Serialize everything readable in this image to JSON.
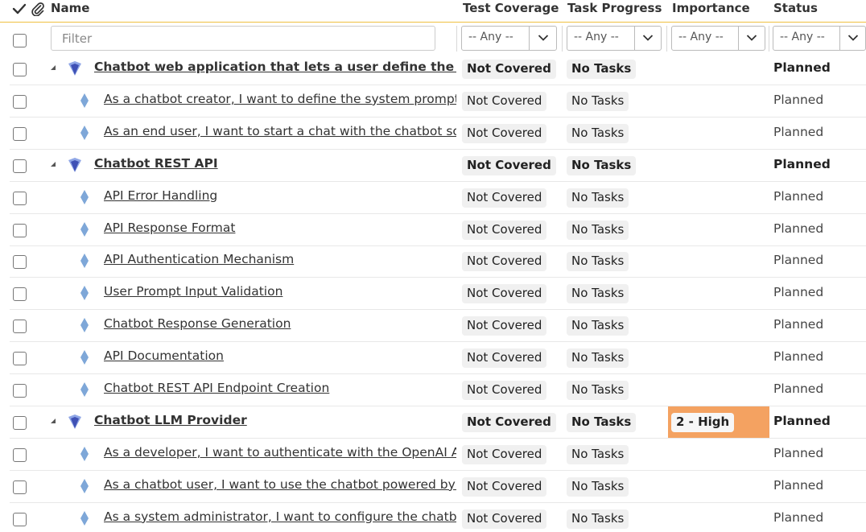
{
  "header": {
    "name": "Name",
    "test_coverage": "Test Coverage",
    "task_progress": "Task Progress",
    "importance": "Importance",
    "status": "Status"
  },
  "filters": {
    "name_placeholder": "Filter",
    "test_coverage": "-- Any --",
    "task_progress": "-- Any --",
    "importance": "-- Any --",
    "status": "-- Any --"
  },
  "colors": {
    "epic_icon": "#3f51b5",
    "requirement_icon": "#7ea7d8",
    "importance_high": "#f4a261",
    "header_underline": "#f0c040"
  },
  "rows": [
    {
      "level": 0,
      "icon": "epic-icon",
      "name": "Chatbot web application that lets a user define the system prompt so the chatbot behaves the way they want",
      "coverage": "Not Covered",
      "progress": "No Tasks",
      "importance": "",
      "status": "Planned"
    },
    {
      "level": 1,
      "icon": "requirement-icon",
      "name": "As a chatbot creator, I want to define the system prompt so the chatbot behaves the way I want",
      "coverage": "Not Covered",
      "progress": "No Tasks",
      "importance": "",
      "status": "Planned"
    },
    {
      "level": 1,
      "icon": "requirement-icon",
      "name": "As an end user, I want to start a chat with the chatbot so that I can ask it questions",
      "coverage": "Not Covered",
      "progress": "No Tasks",
      "importance": "",
      "status": "Planned"
    },
    {
      "level": 0,
      "icon": "epic-icon",
      "name": "Chatbot REST API",
      "coverage": "Not Covered",
      "progress": "No Tasks",
      "importance": "",
      "status": "Planned"
    },
    {
      "level": 1,
      "icon": "requirement-icon",
      "name": "API Error Handling",
      "coverage": "Not Covered",
      "progress": "No Tasks",
      "importance": "",
      "status": "Planned"
    },
    {
      "level": 1,
      "icon": "requirement-icon",
      "name": "API Response Format",
      "coverage": "Not Covered",
      "progress": "No Tasks",
      "importance": "",
      "status": "Planned"
    },
    {
      "level": 1,
      "icon": "requirement-icon",
      "name": "API Authentication Mechanism",
      "coverage": "Not Covered",
      "progress": "No Tasks",
      "importance": "",
      "status": "Planned"
    },
    {
      "level": 1,
      "icon": "requirement-icon",
      "name": "User Prompt Input Validation",
      "coverage": "Not Covered",
      "progress": "No Tasks",
      "importance": "",
      "status": "Planned"
    },
    {
      "level": 1,
      "icon": "requirement-icon",
      "name": "Chatbot Response Generation",
      "coverage": "Not Covered",
      "progress": "No Tasks",
      "importance": "",
      "status": "Planned"
    },
    {
      "level": 1,
      "icon": "requirement-icon",
      "name": "API Documentation",
      "coverage": "Not Covered",
      "progress": "No Tasks",
      "importance": "",
      "status": "Planned"
    },
    {
      "level": 1,
      "icon": "requirement-icon",
      "name": "Chatbot REST API Endpoint Creation",
      "coverage": "Not Covered",
      "progress": "No Tasks",
      "importance": "",
      "status": "Planned"
    },
    {
      "level": 0,
      "icon": "epic-icon",
      "name": "Chatbot LLM Provider",
      "coverage": "Not Covered",
      "progress": "No Tasks",
      "importance": "2 - High",
      "status": "Planned"
    },
    {
      "level": 1,
      "icon": "requirement-icon",
      "name": "As a developer, I want to authenticate with the OpenAI API using an API key",
      "coverage": "Not Covered",
      "progress": "No Tasks",
      "importance": "",
      "status": "Planned"
    },
    {
      "level": 1,
      "icon": "requirement-icon",
      "name": "As a chatbot user, I want to use the chatbot powered by the OpenAI model",
      "coverage": "Not Covered",
      "progress": "No Tasks",
      "importance": "",
      "status": "Planned"
    },
    {
      "level": 1,
      "icon": "requirement-icon",
      "name": "As a system administrator, I want to configure the chatbot to use a specific model",
      "coverage": "Not Covered",
      "progress": "No Tasks",
      "importance": "",
      "status": "Planned"
    }
  ]
}
